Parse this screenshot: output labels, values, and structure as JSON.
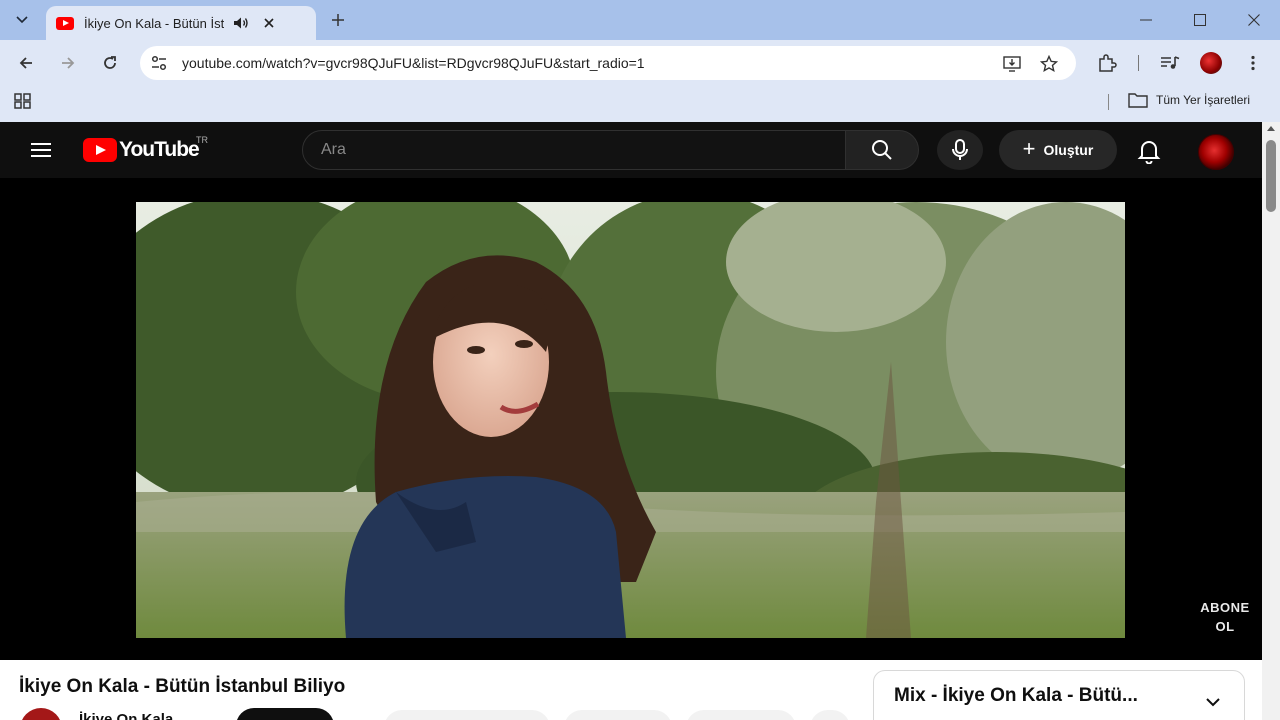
{
  "browser": {
    "tab": {
      "title": "İkiye On Kala - Bütün İstanbul Biliyo"
    },
    "url": "youtube.com/watch?v=gvcr98QJuFU&list=RDgvcr98QJuFU&start_radio=1",
    "bookmarks": {
      "all_label": "Tüm Yer İşaretleri"
    },
    "icons": [
      "tab-search-icon",
      "youtube-favicon-icon",
      "speaker-icon",
      "close-icon",
      "plus-icon",
      "minimize-icon",
      "maximize-icon",
      "back-icon",
      "forward-icon",
      "reload-icon",
      "site-settings-icon",
      "install-app-icon",
      "star-icon",
      "extensions-icon",
      "media-controls-icon",
      "more-icon",
      "apps-grid-icon",
      "folder-icon"
    ]
  },
  "youtube": {
    "logo_text": "YouTube",
    "region": "TR",
    "search": {
      "placeholder": "Ara"
    },
    "create_label": "Oluştur",
    "watermark": {
      "line1": "ABONE",
      "line2": "OL"
    },
    "video": {
      "title": "İkiye On Kala - Bütün İstanbul Biliyo",
      "channel": "İkiye On Kala"
    },
    "mix": {
      "title": "Mix - İkiye On Kala - Bütü..."
    },
    "colors": {
      "brand_red": "#ff0000",
      "background": "#0f0f0f",
      "chrome_tabstrip": "#a7c1ea",
      "chrome_toolbar": "#dfe7f6"
    }
  }
}
